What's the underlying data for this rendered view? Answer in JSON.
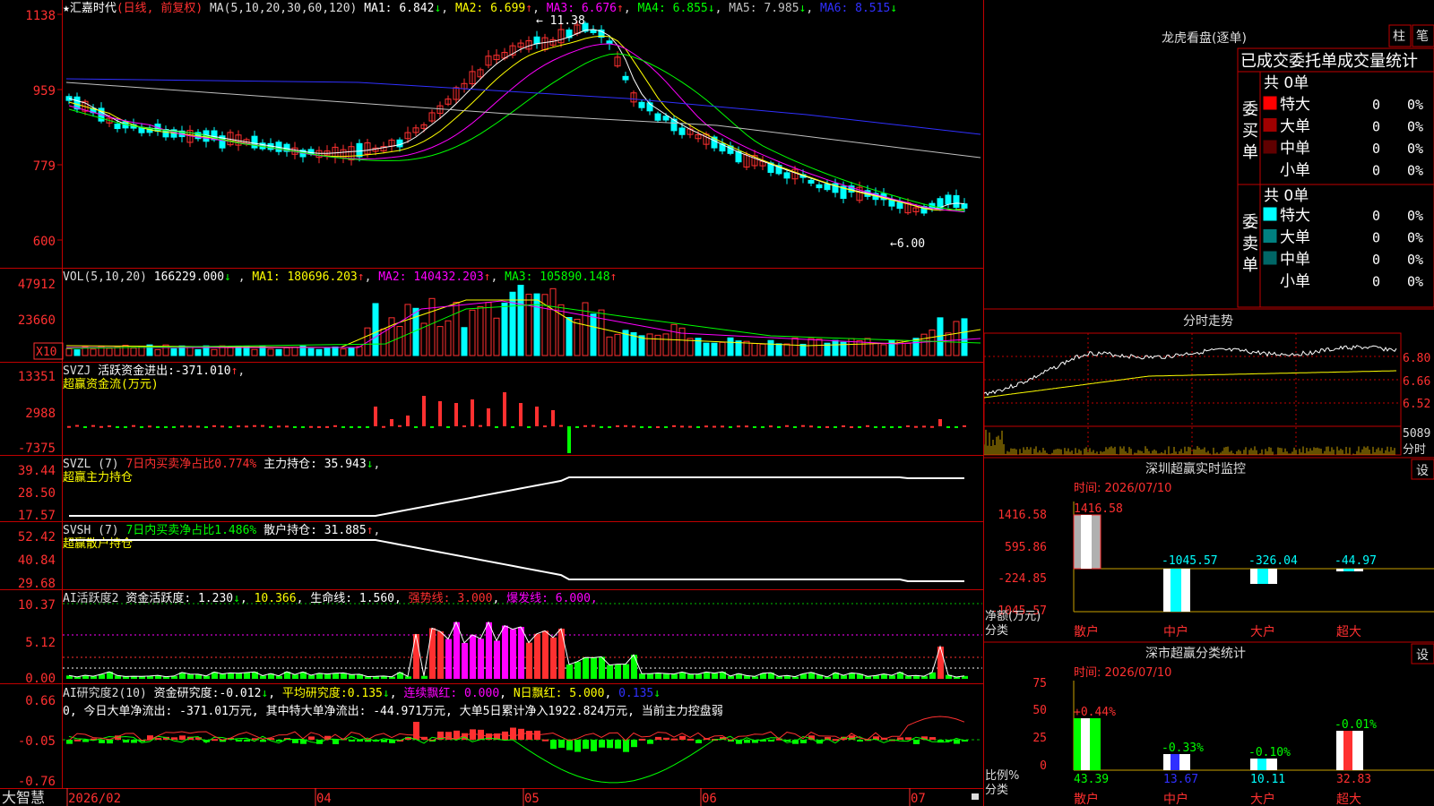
{
  "app_name": "大智慧",
  "stock_name": "汇嘉时代",
  "period_label": "(日线, 前复权)",
  "ma_params": "MA(5,10,20,30,60,120)",
  "ma_values": [
    {
      "label": "MA1:",
      "value": "6.842",
      "arrow": "↓",
      "color": "#ffffff"
    },
    {
      "label": "MA2:",
      "value": "6.699",
      "arrow": "↑",
      "color": "#ffff00"
    },
    {
      "label": "MA3:",
      "value": "6.676",
      "arrow": "↑",
      "color": "#ff00ff"
    },
    {
      "label": "MA4:",
      "value": "6.855",
      "arrow": "↓",
      "color": "#00ff00"
    },
    {
      "label": "MA5:",
      "value": "7.985",
      "arrow": "↓",
      "color": "#c0c0c0"
    },
    {
      "label": "MA6:",
      "value": "8.515",
      "arrow": "↓",
      "color": "#3030ff"
    }
  ],
  "price_axis": [
    "1138",
    "959",
    "779",
    "600"
  ],
  "high_label": "11.38",
  "low_label": "6.00",
  "vol_header": {
    "name": "VOL(5,10,20)",
    "value": "166229.000",
    "arrow": "↓",
    "ma": [
      {
        "label": "MA1:",
        "value": "180696.203",
        "arrow": "↑",
        "color": "#ffff00"
      },
      {
        "label": "MA2:",
        "value": "140432.203",
        "arrow": "↑",
        "color": "#ff00ff"
      },
      {
        "label": "MA3:",
        "value": "105890.148",
        "arrow": "↑",
        "color": "#00ff00"
      }
    ]
  },
  "vol_axis": [
    "47912",
    "23660"
  ],
  "vol_unit": "X10",
  "svzj": {
    "name": "SVZJ",
    "label": "活跃资金进出:",
    "value": "-371.010",
    "arrow": "↑",
    "sub": "超赢资金流(万元)",
    "axis": [
      "13351",
      "2988",
      "-7375"
    ]
  },
  "svzl": {
    "name": "SVZL (7)",
    "pct_label": "7日内买卖净占比0.774%",
    "label": "主力持仓:",
    "value": "35.943",
    "arrow": "↓",
    "sub": "超赢主力持仓",
    "axis": [
      "39.44",
      "28.50",
      "17.57"
    ]
  },
  "svsh": {
    "name": "SVSH (7)",
    "pct_label": "7日内买卖净占比1.486%",
    "label": "散户持仓:",
    "value": "31.885",
    "arrow": "↑",
    "sub": "超赢散户持仓",
    "axis": [
      "52.42",
      "40.84",
      "29.68"
    ]
  },
  "ai1": {
    "name": "AI活跃度2",
    "l1": "资金活跃度:",
    "v1": "1.230",
    "a1": "↓",
    "v2": "10.366",
    "l3": "生命线:",
    "v3": "1.560",
    "l4": "强势线:",
    "v4": "3.000",
    "l5": "爆发线:",
    "v5": "6.000",
    "axis": [
      "10.37",
      "5.12",
      "0.00"
    ]
  },
  "ai2": {
    "name": "AI研究度2(10)",
    "l1": "资金研究度:",
    "v1": "-0.012",
    "a1": "↓",
    "l2": "平均研究度:",
    "v2": "0.135",
    "a2": "↓",
    "l3": "连续飘红:",
    "v3": "0.000",
    "l4": "N日飘红:",
    "v4": "5.000",
    "v5": "0.135",
    "a5": "↓",
    "summary": "0, 今日大单净流出: -371.01万元, 其中特大单净流出: -44.971万元, 大单5日累计净入1922.824万元, 当前主力控盘弱",
    "axis": [
      "0.66",
      "-0.05",
      "-0.76"
    ]
  },
  "date_axis": [
    "2026/02",
    "04",
    "05",
    "06",
    "07"
  ],
  "right": {
    "dragon_title": "龙虎看盘(逐单)",
    "btn_bar": "柱",
    "btn_pen": "笔",
    "tabs": [
      "已成交",
      "委托单",
      "成交量统计"
    ],
    "buy": {
      "side": "委买单",
      "total": "共 0单",
      "rows": [
        {
          "label": "特大",
          "count": "0",
          "pct": "0%",
          "color": "#ff0000"
        },
        {
          "label": "大单",
          "count": "0",
          "pct": "0%",
          "color": "#a00000"
        },
        {
          "label": "中单",
          "count": "0",
          "pct": "0%",
          "color": "#600000"
        },
        {
          "label": "小单",
          "count": "0",
          "pct": "0%",
          "color": "#000000"
        }
      ]
    },
    "sell": {
      "side": "委卖单",
      "total": "共 0单",
      "rows": [
        {
          "label": "特大",
          "count": "0",
          "pct": "0%",
          "color": "#00ffff"
        },
        {
          "label": "大单",
          "count": "0",
          "pct": "0%",
          "color": "#008080"
        },
        {
          "label": "中单",
          "count": "0",
          "pct": "0%",
          "color": "#006666"
        },
        {
          "label": "小单",
          "count": "0",
          "pct": "0%",
          "color": "#000000"
        }
      ]
    },
    "intraday_title": "分时走势",
    "intraday_axis": [
      "6.80",
      "6.66",
      "6.52"
    ],
    "intraday_vol": "5089",
    "intraday_vol_label": "分时",
    "sz_monitor": {
      "title": "深圳超赢实时监控",
      "btn": "设",
      "time": "时间: 2026/07/10",
      "axis": [
        "1416.58",
        "595.86",
        "-224.85",
        "-1045.57"
      ],
      "ylabel": "净额(万元)",
      "xlabel": "分类",
      "categories": [
        "散户",
        "中户",
        "大户",
        "超大"
      ],
      "values": [
        "1416.58",
        "-1045.57",
        "-326.04",
        "-44.97"
      ]
    },
    "sz_class": {
      "title": "深市超赢分类统计",
      "btn": "设",
      "time": "时间: 2026/07/10",
      "axis": [
        "75",
        "50",
        "25",
        "0"
      ],
      "ylabel": "比例%",
      "xlabel": "分类",
      "categories": [
        "散户",
        "中户",
        "大户",
        "超大"
      ],
      "top_labels": [
        "+0.44%",
        "-0.33%",
        "-0.10%",
        "-0.01%"
      ],
      "bottom_values": [
        "43.39",
        "13.67",
        "10.11",
        "32.83"
      ]
    }
  }
}
